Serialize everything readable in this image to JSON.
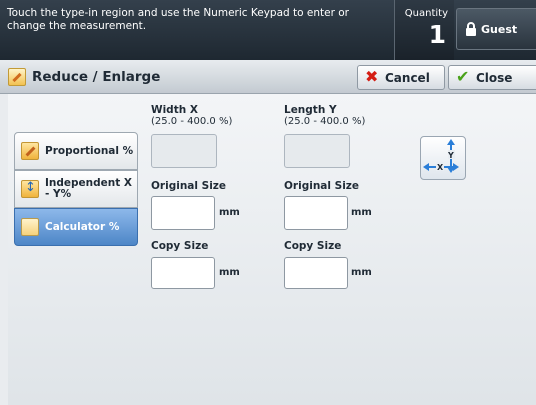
{
  "header": {
    "message": "Touch the type-in region and use the Numeric Keypad to enter or change the measurement.",
    "quantity_label": "Quantity",
    "quantity_value": "1",
    "guest_label": "Guest"
  },
  "titlebar": {
    "title": "Reduce / Enlarge",
    "cancel_label": "Cancel",
    "close_label": "Close"
  },
  "modes": [
    {
      "label": "Proportional %",
      "selected": false
    },
    {
      "label": "Independent X - Y%",
      "selected": false
    },
    {
      "label": "Calculator %",
      "selected": true
    }
  ],
  "width_x": {
    "title": "Width X",
    "range": "(25.0 - 400.0 %)",
    "value": "",
    "original_size_label": "Original Size",
    "original_size_value": "",
    "copy_size_label": "Copy Size",
    "copy_size_value": "",
    "unit": "mm"
  },
  "length_y": {
    "title": "Length Y",
    "range": "(25.0 - 400.0 %)",
    "value": "",
    "original_size_label": "Original Size",
    "original_size_value": "",
    "copy_size_label": "Copy Size",
    "copy_size_value": "",
    "unit": "mm"
  },
  "diagram": {
    "x_label": "X",
    "y_label": "Y"
  },
  "colors": {
    "accent_selected": "#4d86c7",
    "cancel_icon": "#d41d14",
    "close_icon": "#4aa21a"
  }
}
